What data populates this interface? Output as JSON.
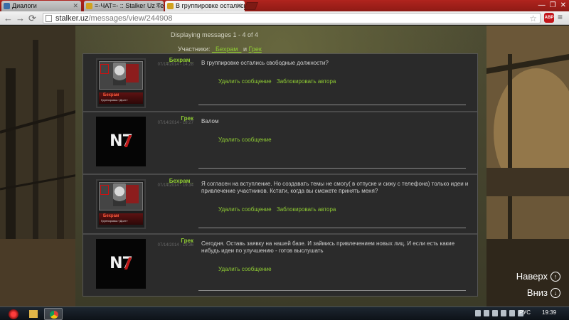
{
  "browser": {
    "tabs": [
      {
        "title": "Диалоги"
      },
      {
        "title": "=-ЧАТ=- :: Stalker Uz Тер"
      },
      {
        "title": "В группировке остались"
      }
    ],
    "url_host": "stalker.uz",
    "url_path": "/messages/view/244908",
    "abp_label": "ABP"
  },
  "page": {
    "pager": "Displaying messages 1 - 4 of 4",
    "participants_label": "Участники:",
    "participants": [
      "_Бехрам_",
      "Грек"
    ],
    "participants_joiner": "и"
  },
  "messages": [
    {
      "author": "_Бехрам_",
      "date": "07/14/2014 - 14:28",
      "avatar": "stalker-avatar",
      "avatar_title": "Бехрам",
      "avatar_sub": "Группировка «Долг»",
      "text": "В группировке остались свободные должности?",
      "actions": [
        "Удалить сообщение",
        "Заблокировать автора"
      ]
    },
    {
      "author": "Грек",
      "date": "07/14/2014 - 18:27",
      "avatar": "n7-avatar",
      "avatar_text": "N7",
      "text": "Валом",
      "actions": [
        "Удалить сообщение"
      ]
    },
    {
      "author": "_Бехрам_",
      "date": "07/14/2014 - 19:34",
      "avatar": "stalker-avatar",
      "avatar_title": "Бехрам",
      "avatar_sub": "Группировка «Долг»",
      "text": "Я согласен на вступление. Но создавать темы не смогу( в отпуске и сижу с телефона) только идеи и привлечение участников. Кстати, когда вы сможете принять меня?",
      "actions": [
        "Удалить сообщение",
        "Заблокировать автора"
      ]
    },
    {
      "author": "Грек",
      "date": "07/14/2014 - 19:36",
      "avatar": "n7-avatar",
      "avatar_text": "N7",
      "text": "Сегодня. Оставь заявку на нашей базе. И займись привлечением новых лиц. И если есть какие нибудь идеи по улучшению - готов выслушать",
      "actions": [
        "Удалить сообщение"
      ]
    }
  ],
  "scroll": {
    "up_label": "Наверх",
    "down_label": "Вниз"
  },
  "taskbar": {
    "lang": "РУС",
    "clock": "19:39"
  },
  "colors": {
    "browser_frame": "#b0241e",
    "link_green": "#8fcc33",
    "thread_bg": "#2b2b2b"
  }
}
